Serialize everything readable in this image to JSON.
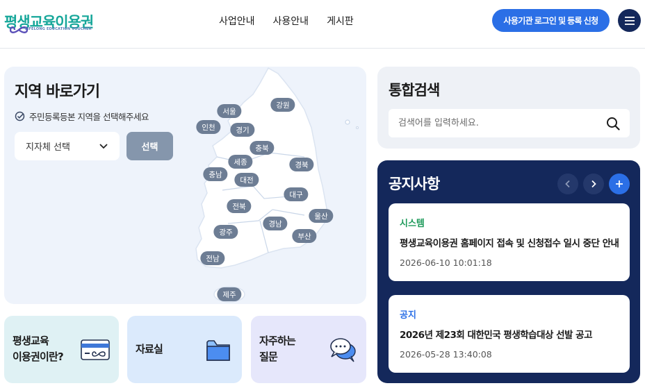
{
  "header": {
    "logo_text": "평생교육이용권",
    "logo_sub": "LIFELONG EDUCATION VOUCHER",
    "nav": [
      "사업안내",
      "사용안내",
      "게시판"
    ],
    "login_label": "사용기관 로그인 및 등록 신청"
  },
  "region": {
    "title": "지역 바로가기",
    "hint": "주민등록등본 지역을 선택해주세요",
    "select_value": "지자체 선택",
    "select_button": "선택",
    "labels": [
      "서울",
      "강원",
      "인천",
      "경기",
      "충북",
      "세종",
      "경북",
      "충남",
      "대전",
      "대구",
      "전북",
      "울산",
      "경남",
      "광주",
      "부산",
      "전남",
      "제주"
    ]
  },
  "tiles": {
    "about": "평생교육 이용권이란?",
    "about_line1": "평생교육",
    "about_line2": "이용권이란?",
    "library": "자료실",
    "faq_line1": "자주하는",
    "faq_line2": "질문"
  },
  "search": {
    "title": "통합검색",
    "placeholder": "검색어를 입력하세요."
  },
  "notice": {
    "title": "공지사항",
    "items": [
      {
        "category": "시스템",
        "title": "평생교육이용권 홈페이지 접속 및 신청접수 일시 중단 안내",
        "date": "2026-06-10 10:01:18"
      },
      {
        "category": "공지",
        "title": "2026년 제23회 대한민국 평생학습대상 선발 공고",
        "date": "2026-05-28 13:40:08"
      }
    ]
  },
  "colors": {
    "primary": "#2b6fe6",
    "navy": "#14285b",
    "teal": "#17a79a",
    "category_system": "#1d9a5a",
    "category_notice": "#2b6fe6",
    "tile_about": "#dff1f4",
    "tile_library": "#dbeafc",
    "tile_faq": "#e6e7fb"
  },
  "icons": {
    "menu": "hamburger-icon",
    "search": "magnifier-icon",
    "prev": "chevron-left-icon",
    "next": "chevron-right-icon",
    "add": "plus-icon"
  }
}
